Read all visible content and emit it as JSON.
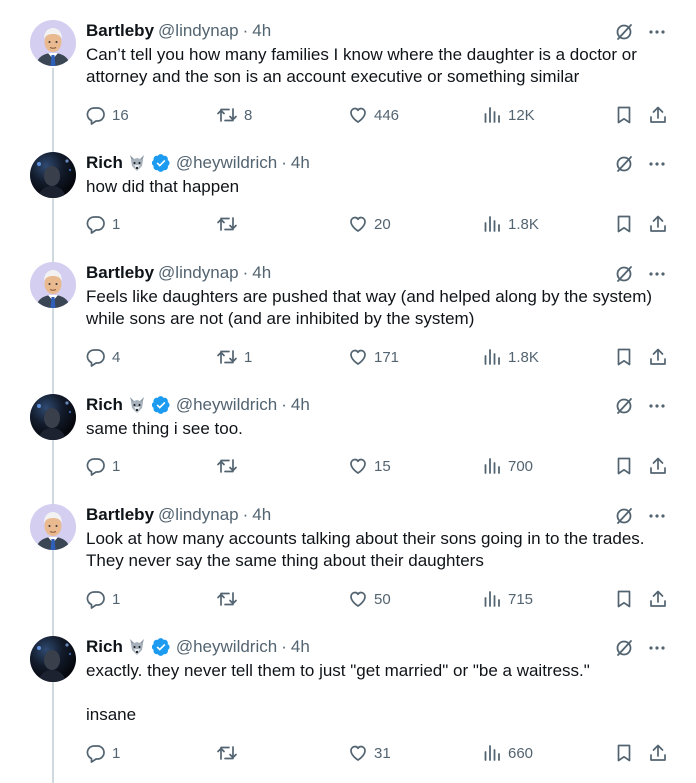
{
  "tweets": [
    {
      "author": "Bartleby",
      "handle": "@lindynap",
      "sep": "·",
      "time": "4h",
      "avatar": "cartoon-man-avatar",
      "text": "Can’t tell you how many families I know where the daughter is a doctor or attorney and the son is an account executive or something similar",
      "replies": "16",
      "retweets": "8",
      "likes": "446",
      "views": "12K"
    },
    {
      "author": "Rich",
      "emoji": "wolf-emoji",
      "verified": true,
      "handle": "@heywildrich",
      "sep": "·",
      "time": "4h",
      "avatar": "dark-photo-avatar",
      "text": "how did that happen",
      "replies": "1",
      "retweets": "",
      "likes": "20",
      "views": "1.8K"
    },
    {
      "author": "Bartleby",
      "handle": "@lindynap",
      "sep": "·",
      "time": "4h",
      "avatar": "cartoon-man-avatar",
      "text": "Feels like daughters are pushed that way (and helped along by the system) while sons are not (and are inhibited by the system)",
      "replies": "4",
      "retweets": "1",
      "likes": "171",
      "views": "1.8K"
    },
    {
      "author": "Rich",
      "emoji": "wolf-emoji",
      "verified": true,
      "handle": "@heywildrich",
      "sep": "·",
      "time": "4h",
      "avatar": "dark-photo-avatar",
      "text": "same thing i see too.",
      "replies": "1",
      "retweets": "",
      "likes": "15",
      "views": "700"
    },
    {
      "author": "Bartleby",
      "handle": "@lindynap",
      "sep": "·",
      "time": "4h",
      "avatar": "cartoon-man-avatar",
      "text": "Look at how many accounts talking about their sons going in to the trades. They never say the same thing about their daughters",
      "replies": "1",
      "retweets": "",
      "likes": "50",
      "views": "715"
    },
    {
      "author": "Rich",
      "emoji": "wolf-emoji",
      "verified": true,
      "handle": "@heywildrich",
      "sep": "·",
      "time": "4h",
      "avatar": "dark-photo-avatar",
      "text": "exactly. they never tell them to just \"get married\" or \"be a waitress.\"\n\ninsane",
      "replies": "1",
      "retweets": "",
      "likes": "31",
      "views": "660"
    }
  ],
  "colors": {
    "text": "#0f1419",
    "secondary": "#536471",
    "verified": "#1d9bf0",
    "thread_line": "#cfd9de"
  },
  "icons": [
    "grok-slash-icon",
    "more-icon",
    "reply-icon",
    "retweet-icon",
    "like-icon",
    "views-icon",
    "bookmark-icon",
    "share-icon"
  ]
}
